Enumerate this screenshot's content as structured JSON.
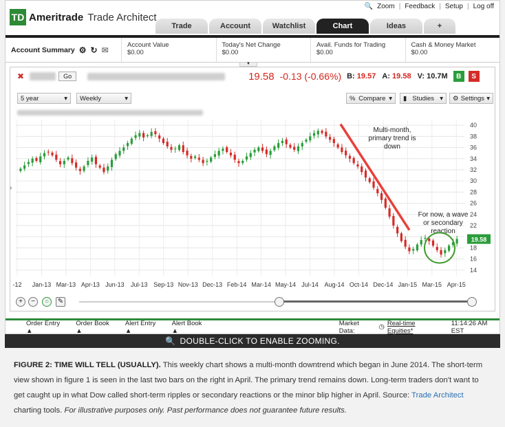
{
  "header": {
    "logo_mark": "TD",
    "brand": "Ameritrade",
    "product": "Trade Architect",
    "links": [
      "Zoom",
      "Feedback",
      "Setup",
      "Log off"
    ]
  },
  "tabs": [
    "Trade",
    "Account",
    "Watchlist",
    "Chart",
    "Ideas",
    "+"
  ],
  "active_tab": "Chart",
  "account": {
    "title": "Account Summary",
    "cells": [
      {
        "label": "Account Value",
        "value": "$0.00"
      },
      {
        "label": "Today's Net Change",
        "value": "$0.00"
      },
      {
        "label": "Avail. Funds for Trading",
        "value": "$0.00"
      },
      {
        "label": "Cash & Money Market",
        "value": "$0.00"
      }
    ]
  },
  "quote": {
    "go_label": "Go",
    "price": "19.58",
    "change": "-0.13 (-0.66%)",
    "bid_label": "B:",
    "bid": "19.57",
    "ask_label": "A:",
    "ask": "19.58",
    "vol_label": "V:",
    "vol": "10.7M",
    "buy": "B",
    "sell": "S"
  },
  "controls": {
    "range": "5 year",
    "interval": "Weekly",
    "compare": "Compare",
    "studies": "Studies",
    "settings": "Settings"
  },
  "chart_data": {
    "type": "candlestick",
    "y_ticks": [
      14,
      16,
      18,
      20,
      22,
      24,
      26,
      28,
      30,
      32,
      34,
      36,
      38,
      40
    ],
    "ylim": [
      13,
      41
    ],
    "x_tick_labels": [
      "-12",
      "Jan-13",
      "Mar-13",
      "Apr-13",
      "Jun-13",
      "Jul-13",
      "Sep-13",
      "Nov-13",
      "Dec-13",
      "Feb-14",
      "Mar-14",
      "May-14",
      "Jul-14",
      "Aug-14",
      "Oct-14",
      "Dec-14",
      "Jan-15",
      "Mar-15",
      "Apr-15"
    ],
    "last_price_tag": "19.58",
    "close_series": [
      32.2,
      32.8,
      33.4,
      34.0,
      33.6,
      34.4,
      35.0,
      35.2,
      34.6,
      33.8,
      33.0,
      33.6,
      34.2,
      33.2,
      32.4,
      31.8,
      32.6,
      33.6,
      34.2,
      33.0,
      32.4,
      31.6,
      32.6,
      33.8,
      34.8,
      35.4,
      36.0,
      36.8,
      37.6,
      38.2,
      38.6,
      37.8,
      38.2,
      38.8,
      38.4,
      37.6,
      36.8,
      36.2,
      35.6,
      35.8,
      36.4,
      35.2,
      34.6,
      34.0,
      34.4,
      33.8,
      33.2,
      33.6,
      34.2,
      34.8,
      35.4,
      35.8,
      35.2,
      34.6,
      33.8,
      33.2,
      33.6,
      34.4,
      35.0,
      35.6,
      36.0,
      35.4,
      34.8,
      35.4,
      36.2,
      36.8,
      37.2,
      36.6,
      36.0,
      35.6,
      36.2,
      36.8,
      37.4,
      38.0,
      38.6,
      39.0,
      38.6,
      38.0,
      37.4,
      36.8,
      36.0,
      35.2,
      34.6,
      34.0,
      33.2,
      32.6,
      31.6,
      30.6,
      29.8,
      28.8,
      27.8,
      26.6,
      25.2,
      23.6,
      22.0,
      20.6,
      19.2,
      18.2,
      17.4,
      17.8,
      18.6,
      19.4,
      19.8,
      19.2,
      18.4,
      17.6,
      16.8,
      17.6,
      18.4,
      19.0,
      19.6
    ],
    "annotations": [
      {
        "text": [
          "Multi-month,",
          "primary trend is",
          "down"
        ]
      },
      {
        "text": [
          "For now, a wave",
          "or secondary",
          "reaction"
        ]
      }
    ]
  },
  "bottombar": {
    "items": [
      "Order Entry ▲",
      "Order Book ▲",
      "Alert Entry ▲",
      "Alert Book ▲"
    ],
    "market_data_label": "Market Data:",
    "market_data_value": "Real-time Equities*",
    "time": "11:14:26 AM EST"
  },
  "zoom_hint": "DOUBLE-CLICK TO ENABLE ZOOMING.",
  "caption": {
    "bold": "FIGURE 2: TIME WILL TELL (USUALLY).",
    "text1": " This weekly chart shows a multi-month downtrend which began in June 2014. The short-term view shown in figure 1 is seen in the last two bars on the right in April. The primary trend remains down. Long-term traders don't want to get caught up in what Dow called short-term ripples or secondary reactions or the minor blip higher in April. Source: ",
    "link": "Trade Architect",
    "text2": " charting tools. ",
    "italic": "For illustrative purposes only. Past performance does not guarantee future results."
  },
  "colors": {
    "up": "#2a9d3a",
    "down": "#d52b27",
    "trend_line": "#e8403b",
    "wave_circle": "#3f9b2e"
  }
}
